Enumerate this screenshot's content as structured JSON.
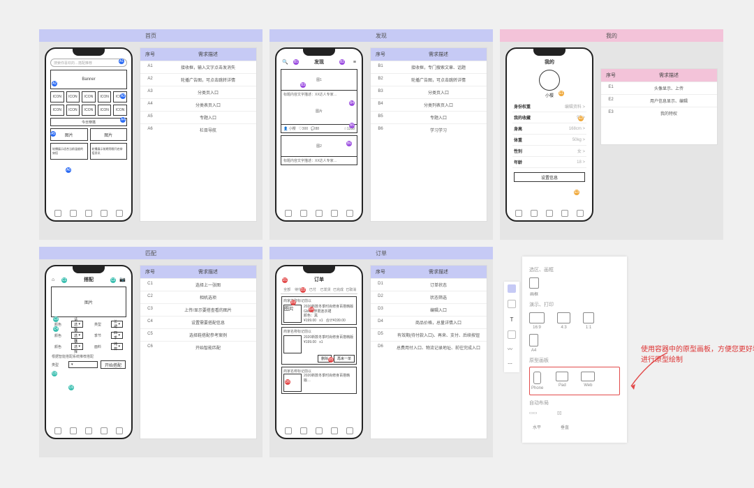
{
  "panels": {
    "home": {
      "title": "首页",
      "table_head": [
        "序号",
        "需求描述"
      ],
      "rows": [
        [
          "A1",
          "接收框，输入文字点击发消失"
        ],
        [
          "A2",
          "轮播广告图，可点击跳转详情"
        ],
        [
          "A3",
          "分类页入口"
        ],
        [
          "A4",
          "分类表页入口"
        ],
        [
          "A5",
          "专题入口"
        ],
        [
          "A6",
          "栏目导航"
        ]
      ]
    },
    "discover": {
      "title": "发现",
      "screen_title": "发现",
      "card_label": "图1",
      "table_head": [
        "序号",
        "需求描述"
      ],
      "rows": [
        [
          "B1",
          "接收框，专门搜索文章、话题"
        ],
        [
          "B2",
          "轮播广告图，可点击跳转详情"
        ],
        [
          "B3",
          "分类页入口"
        ],
        [
          "B4",
          "分类列表页入口"
        ],
        [
          "B5",
          "专题入口"
        ],
        [
          "B6",
          "学习学习"
        ]
      ]
    },
    "mine": {
      "title": "我的",
      "screen_title": "我的",
      "username": "小樱",
      "list": [
        [
          "身份权重",
          "编辑资料 >"
        ],
        [
          "我的收藏",
          "99 >"
        ],
        [
          "身高",
          "168cm >"
        ],
        [
          "体重",
          "50kg >"
        ],
        [
          "性别",
          "女 >"
        ],
        [
          "年龄",
          "18 >"
        ]
      ],
      "cta": "设置信息",
      "table_head": [
        "序号",
        "需求描述"
      ],
      "rows": [
        [
          "E1",
          "头像显示、上传"
        ],
        [
          "E2",
          "用户信息显示、编辑"
        ],
        [
          "E3",
          "我的特权"
        ]
      ]
    },
    "match": {
      "title": "匹配",
      "screen_title": "搭配",
      "media": "图片",
      "form": [
        [
          "颜色",
          "请选择"
        ],
        [
          "颜色",
          "请选择"
        ],
        [
          "颜色",
          "请选择"
        ],
        [
          "类型",
          "长裙"
        ],
        [
          "季节",
          "四季"
        ],
        [
          "面料",
          "纯棉"
        ]
      ],
      "rec_label": "根据智能搭配系统推荐搭配",
      "start_btn": "开始搭配",
      "table_head": [
        "序号",
        "需求描述"
      ],
      "rows": [
        [
          "C1",
          "选择上一张图"
        ],
        [
          "C2",
          "相机选项"
        ],
        [
          "C3",
          "上传/显示要搭查看的图片"
        ],
        [
          "C4",
          "设置需要搭配信息"
        ],
        [
          "C5",
          "选择鞋搭配参考案例"
        ],
        [
          "C6",
          "开始智能匹配"
        ]
      ]
    },
    "orders": {
      "title": "订单",
      "screen_title": "订单",
      "tabs": [
        "全部",
        "待付款",
        "已付",
        "已发货",
        "已完成",
        "已取消"
      ],
      "buttons": [
        "删除",
        "再来一单"
      ],
      "table_head": [
        "序号",
        "需求描述"
      ],
      "rows": [
        [
          "D1",
          "订单状态"
        ],
        [
          "D2",
          "状态筛选"
        ],
        [
          "D3",
          "编辑入口"
        ],
        [
          "D4",
          "商品价格，总量详情入口"
        ],
        [
          "D5",
          "有效期(待付款入口)、再来、支付、后续按钮"
        ],
        [
          "D6",
          "总费用付入口、物流记录地址、前往完成入口"
        ]
      ]
    }
  },
  "palette": {
    "sections": {
      "draw": {
        "title": "选区、画框",
        "items": [
          "画框"
        ]
      },
      "present": {
        "title": "演示、打印",
        "items": [
          "16:9",
          "4:3",
          "1:1",
          "A4"
        ]
      },
      "proto": {
        "title": "原型画板",
        "items": [
          "Phone",
          "Pad",
          "Web"
        ]
      },
      "auto": {
        "title": "自动布局",
        "items": [
          "水平",
          "垂直"
        ]
      }
    }
  },
  "annotation": "使用容器中的原型画板，方便您更好地进行原型绘制"
}
